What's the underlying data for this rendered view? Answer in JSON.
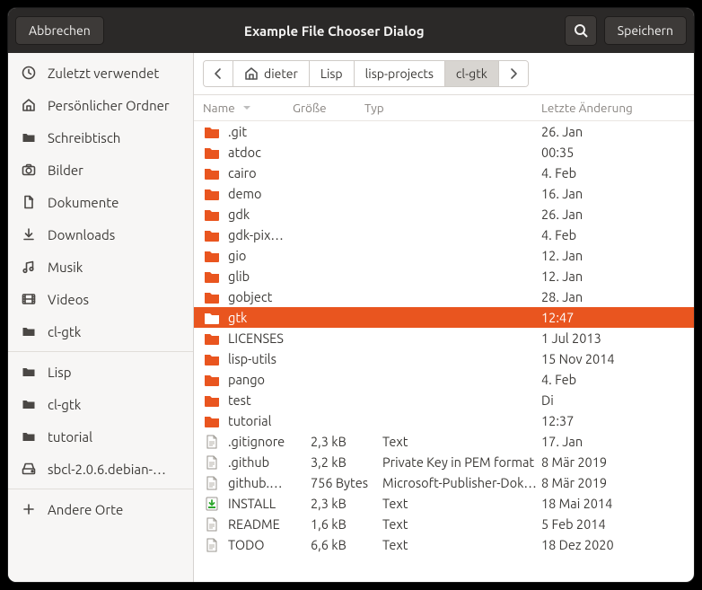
{
  "titlebar": {
    "cancel": "Abbrechen",
    "title": "Example File Chooser Dialog",
    "save": "Speichern"
  },
  "sidebar": {
    "items": [
      {
        "icon": "clock",
        "label": "Zuletzt verwendet"
      },
      {
        "icon": "home",
        "label": "Persönlicher Ordner"
      },
      {
        "icon": "folder",
        "label": "Schreibtisch"
      },
      {
        "icon": "camera",
        "label": "Bilder"
      },
      {
        "icon": "doc",
        "label": "Dokumente"
      },
      {
        "icon": "download",
        "label": "Downloads"
      },
      {
        "icon": "music",
        "label": "Musik"
      },
      {
        "icon": "video",
        "label": "Videos"
      },
      {
        "icon": "folder",
        "label": "cl-gtk"
      },
      {
        "icon": "folder",
        "label": "Lisp"
      },
      {
        "icon": "folder",
        "label": "cl-gtk"
      },
      {
        "icon": "folder",
        "label": "tutorial"
      },
      {
        "icon": "drive",
        "label": "sbcl-2.0.6.debian-…"
      },
      {
        "icon": "plus",
        "label": "Andere Orte"
      }
    ],
    "separators_after": [
      8,
      12
    ]
  },
  "breadcrumbs": [
    "dieter",
    "Lisp",
    "lisp-projects",
    "cl-gtk"
  ],
  "breadcrumb_active": "cl-gtk",
  "columns": {
    "name": "Name",
    "size": "Größe",
    "type": "Typ",
    "modified": "Letzte Änderung"
  },
  "rows": [
    {
      "icon": "folder",
      "name": ".git",
      "size": "",
      "type": "",
      "mod": "26. Jan"
    },
    {
      "icon": "folder",
      "name": "atdoc",
      "size": "",
      "type": "",
      "mod": "00:35"
    },
    {
      "icon": "folder",
      "name": "cairo",
      "size": "",
      "type": "",
      "mod": "4. Feb"
    },
    {
      "icon": "folder",
      "name": "demo",
      "size": "",
      "type": "",
      "mod": "16. Jan"
    },
    {
      "icon": "folder",
      "name": "gdk",
      "size": "",
      "type": "",
      "mod": "26. Jan"
    },
    {
      "icon": "folder",
      "name": "gdk-pix…",
      "size": "",
      "type": "",
      "mod": "4. Feb"
    },
    {
      "icon": "folder",
      "name": "gio",
      "size": "",
      "type": "",
      "mod": "12. Jan"
    },
    {
      "icon": "folder",
      "name": "glib",
      "size": "",
      "type": "",
      "mod": "12. Jan"
    },
    {
      "icon": "folder",
      "name": "gobject",
      "size": "",
      "type": "",
      "mod": "28. Jan"
    },
    {
      "icon": "folder-open",
      "name": "gtk",
      "size": "",
      "type": "",
      "mod": "12:47",
      "selected": true
    },
    {
      "icon": "folder",
      "name": "LICENSES",
      "size": "",
      "type": "",
      "mod": "1 Jul 2013"
    },
    {
      "icon": "folder",
      "name": "lisp-utils",
      "size": "",
      "type": "",
      "mod": "15 Nov 2014"
    },
    {
      "icon": "folder",
      "name": "pango",
      "size": "",
      "type": "",
      "mod": "4. Feb"
    },
    {
      "icon": "folder",
      "name": "test",
      "size": "",
      "type": "",
      "mod": "Di"
    },
    {
      "icon": "folder",
      "name": "tutorial",
      "size": "",
      "type": "",
      "mod": "12:37"
    },
    {
      "icon": "file",
      "name": ".gitignore",
      "size": "2,3 kB",
      "type": "Text",
      "mod": "17. Jan"
    },
    {
      "icon": "file",
      "name": ".github",
      "size": "3,2 kB",
      "type": "Private Key in PEM format",
      "mod": "8 Mär 2019"
    },
    {
      "icon": "file",
      "name": "github.…",
      "size": "756 Bytes",
      "type": "Microsoft-Publisher-Dokument",
      "mod": "8 Mär 2019"
    },
    {
      "icon": "install",
      "name": "INSTALL",
      "size": "2,3 kB",
      "type": "Text",
      "mod": "18 Mai 2014"
    },
    {
      "icon": "file",
      "name": "README",
      "size": "1,6 kB",
      "type": "Text",
      "mod": "5 Feb 2014"
    },
    {
      "icon": "file",
      "name": "TODO",
      "size": "6,6 kB",
      "type": "Text",
      "mod": "18 Dez 2020"
    }
  ]
}
